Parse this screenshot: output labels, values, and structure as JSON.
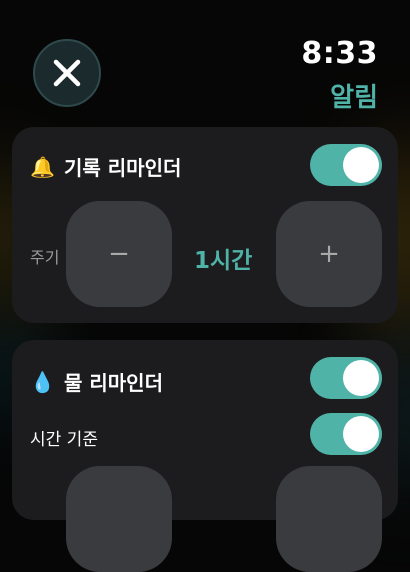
{
  "status": {
    "time": "8:33"
  },
  "header": {
    "title": "알림",
    "accent_color": "#4fb3a8"
  },
  "record_reminder": {
    "emoji": "🔔",
    "label": "기록 리마인더",
    "enabled": true,
    "interval_label": "주기",
    "interval_value": "1시간",
    "minus": "−",
    "plus": "+"
  },
  "water_reminder": {
    "emoji": "💧",
    "label": "물 리마인더",
    "enabled": true,
    "time_based_label": "시간 기준",
    "time_based_enabled": true
  }
}
